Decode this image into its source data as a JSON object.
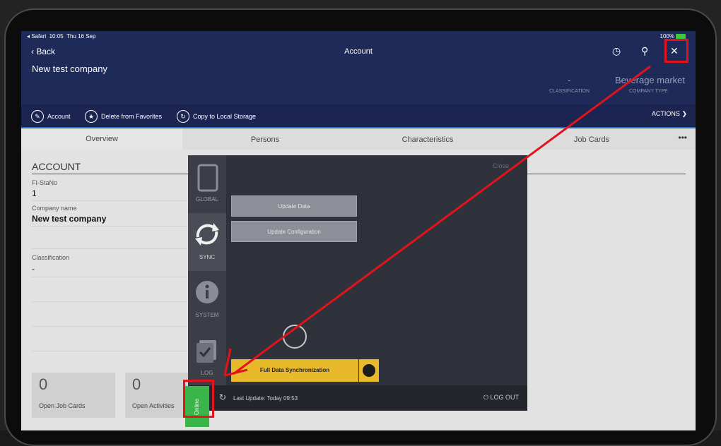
{
  "status_bar": {
    "app": "◂ Safari",
    "time": "10:05",
    "date": "Thu 16 Sep",
    "battery": "100%"
  },
  "header": {
    "back_label": "Back",
    "title": "Account",
    "company_name": "New test company",
    "classification_value": "-",
    "classification_label": "CLASSIFICATION",
    "company_type_value": "Beverage market",
    "company_type_label": "COMPANY TYPE"
  },
  "actions": {
    "account": "Account",
    "delete_favorites": "Delete from Favorites",
    "copy_local": "Copy to Local Storage",
    "actions_label": "ACTIONS"
  },
  "tabs": [
    "Overview",
    "Persons",
    "Characteristics",
    "Job Cards"
  ],
  "more": "•••",
  "section": {
    "title": "ACCOUNT",
    "fi_stano_label": "FI-StaNo",
    "fi_stano_value": "1",
    "company_name_label": "Company name",
    "company_name_value": "New test company",
    "classification_label": "Classification",
    "classification_value": "-"
  },
  "cards": [
    {
      "count": "0",
      "label": "Open Job Cards"
    },
    {
      "count": "0",
      "label": "Open Activities"
    }
  ],
  "panel": {
    "close_label": "Close",
    "rail": [
      "GLOBAL",
      "SYNC",
      "SYSTEM",
      "LOG"
    ],
    "update_data": "Update Data",
    "update_configuration": "Update Configuration",
    "full_sync": "Full Data Synchronization",
    "last_update": "Last Update: Today 09:53",
    "logout": "LOG OUT",
    "online": "Online"
  },
  "colors": {
    "header": "#1e2a57",
    "highlight": "#e3121b",
    "online": "#3ab54a",
    "sync_button": "#e8b92b"
  }
}
